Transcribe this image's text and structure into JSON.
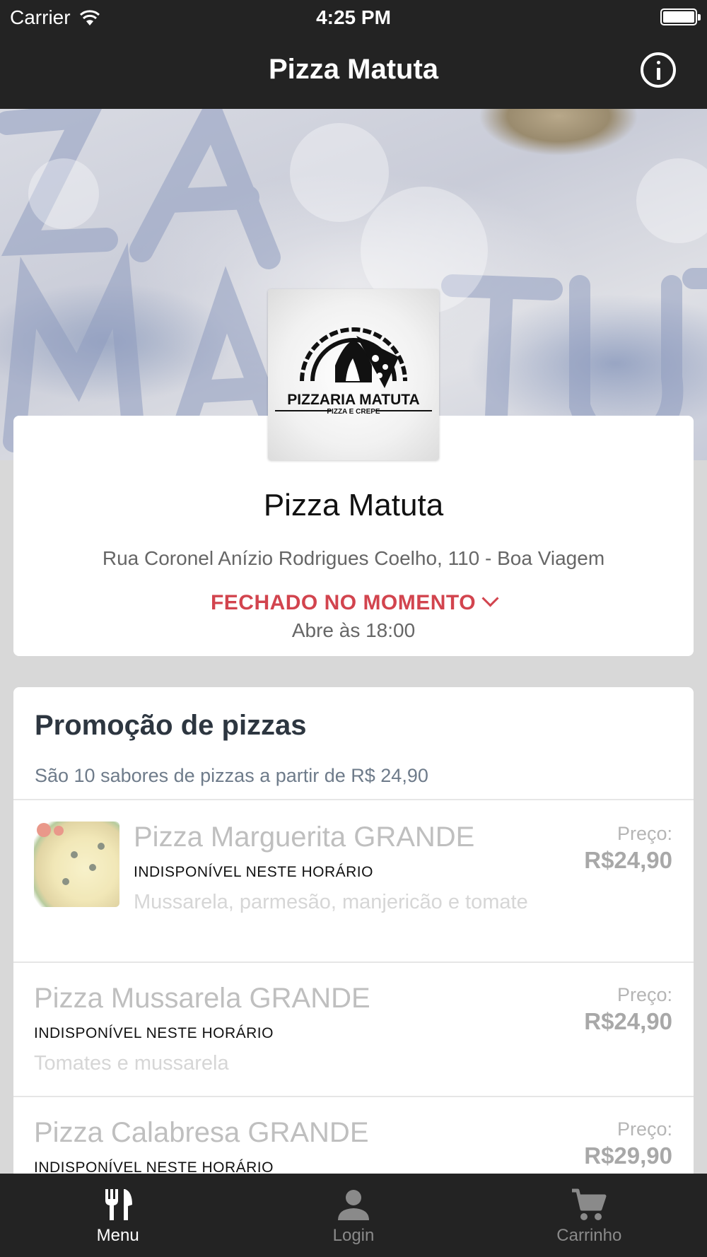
{
  "status_bar": {
    "carrier": "Carrier",
    "time": "4:25 PM"
  },
  "nav": {
    "title": "Pizza Matuta",
    "info_icon": "info-circle-icon"
  },
  "store": {
    "logo_text": "PIZZARIA MATUTA",
    "logo_subtext": "PIZZA E CREPE",
    "name": "Pizza Matuta",
    "address": "Rua Coronel Anízio Rodrigues Coelho, 110 - Boa Viagem",
    "status": "FECHADO NO MOMENTO",
    "opens": "Abre às 18:00"
  },
  "menu": {
    "section_title": "Promoção de pizzas",
    "section_desc": "São 10 sabores de pizzas a partir de R$ 24,90",
    "items": [
      {
        "name": "Pizza Marguerita GRANDE",
        "availability": "INDISPONÍVEL NESTE HORÁRIO",
        "desc": "Mussarela, parmesão, manjericão e tomate",
        "price_label": "Preço:",
        "price": "R$24,90"
      },
      {
        "name": "Pizza Mussarela GRANDE",
        "availability": "INDISPONÍVEL NESTE HORÁRIO",
        "desc": "Tomates e mussarela",
        "price_label": "Preço:",
        "price": "R$24,90"
      },
      {
        "name": "Pizza Calabresa GRANDE",
        "availability": "INDISPONÍVEL NESTE HORÁRIO",
        "price_label": "Preço:",
        "price": "R$29,90"
      }
    ]
  },
  "tabs": [
    {
      "label": "Menu",
      "icon": "fork-knife-icon",
      "active": true
    },
    {
      "label": "Login",
      "icon": "person-icon",
      "active": false
    },
    {
      "label": "Carrinho",
      "icon": "cart-icon",
      "active": false
    }
  ],
  "colors": {
    "bar_background": "#232323",
    "closed_status": "#d2444e",
    "page_background": "#d8d8d8"
  }
}
